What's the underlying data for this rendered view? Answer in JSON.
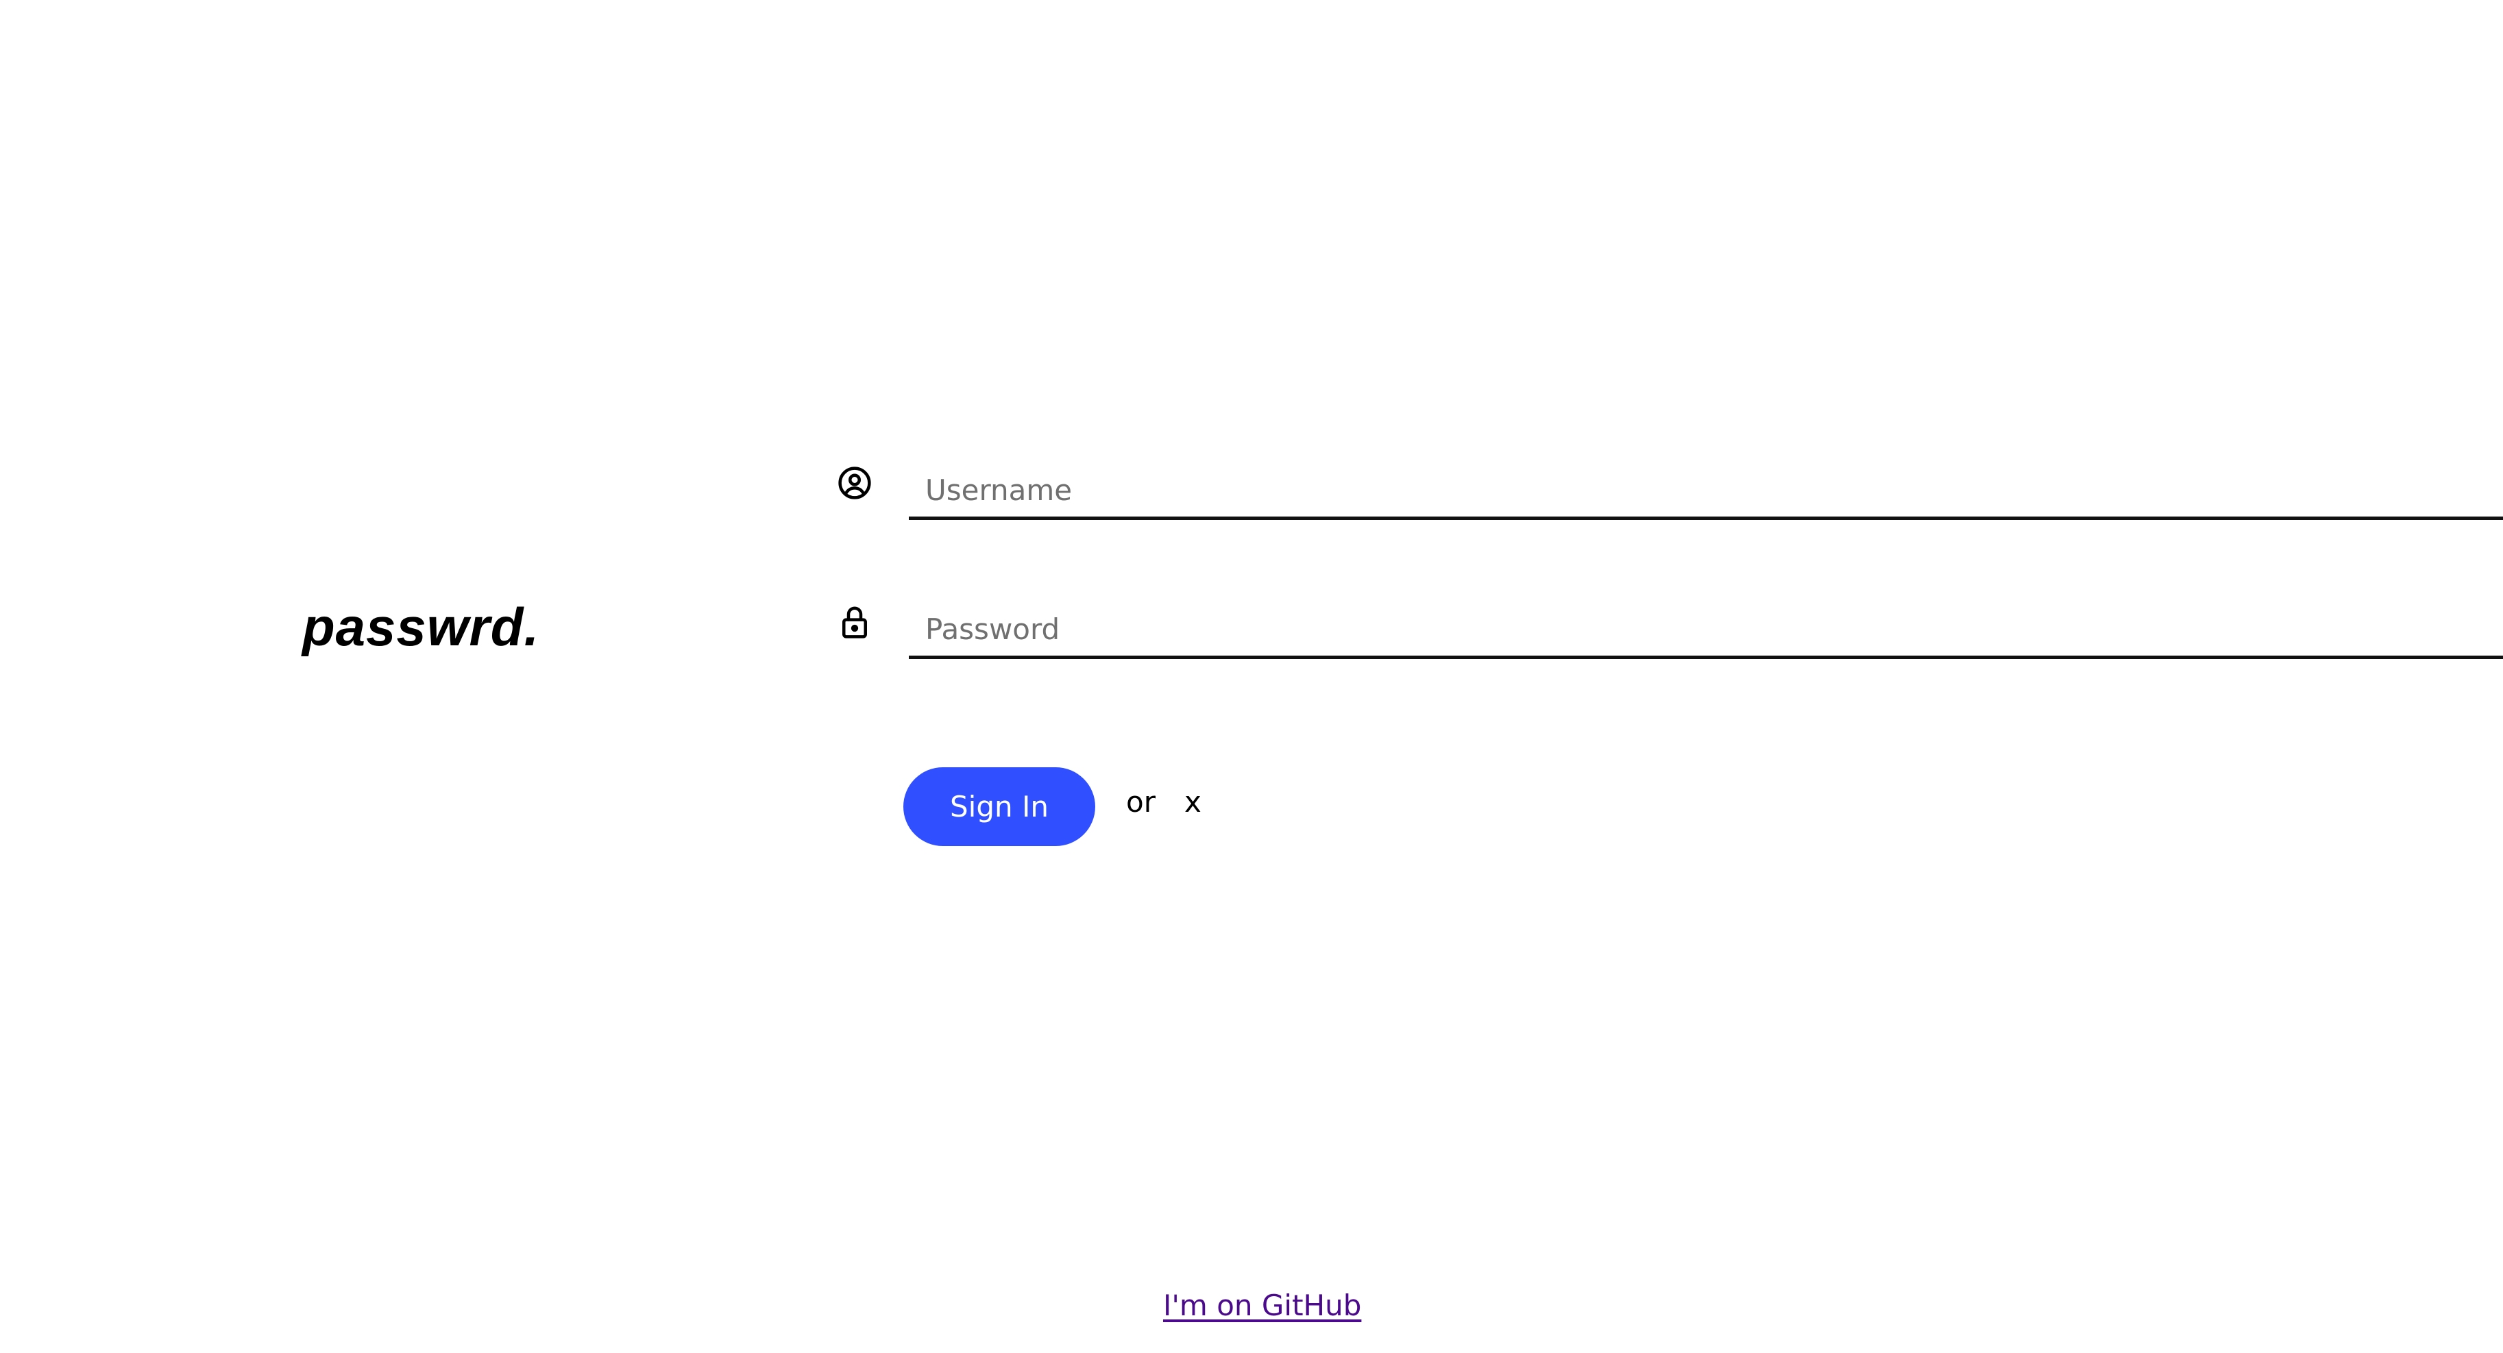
{
  "logo": {
    "text": "passwrd."
  },
  "form": {
    "username": {
      "placeholder": "Username",
      "value": ""
    },
    "password": {
      "placeholder": "Password",
      "value": ""
    },
    "signin_label": "Sign In",
    "or_label": "or",
    "alt_label": "x"
  },
  "footer": {
    "github_label": "I'm on GitHub"
  },
  "icons": {
    "username": "user-circle-icon",
    "password": "lock-icon"
  },
  "colors": {
    "accent": "#3050ff",
    "link_visited": "#4b0a8c",
    "underline": "#111111",
    "placeholder": "#707070"
  }
}
